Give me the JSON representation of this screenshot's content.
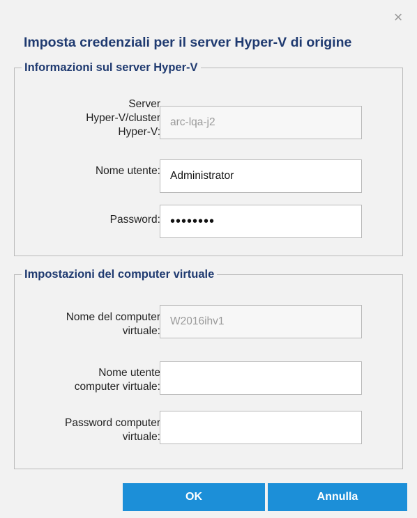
{
  "dialog": {
    "title": "Imposta credenziali per il server Hyper-V di origine",
    "close_symbol": "×"
  },
  "server_section": {
    "legend": "Informazioni sul server Hyper-V",
    "server_label": [
      "Server",
      "Hyper-V/cluster",
      "Hyper-V:"
    ],
    "server_value": "arc-lqa-j2",
    "username_label": "Nome utente:",
    "username_value": "Administrator",
    "password_label": "Password:",
    "password_value": "••••••••"
  },
  "vm_section": {
    "legend": "Impostazioni del computer virtuale",
    "vm_name_label": [
      "Nome del computer",
      "virtuale:"
    ],
    "vm_name_value": "W2016ihv1",
    "vm_username_label": [
      "Nome utente",
      "computer virtuale:"
    ],
    "vm_username_value": "",
    "vm_password_label": [
      "Password computer",
      "virtuale:"
    ],
    "vm_password_value": ""
  },
  "buttons": {
    "ok": "OK",
    "cancel": "Annulla"
  },
  "colors": {
    "title": "#1f3a70",
    "button": "#1c8fd8",
    "background": "#f2f2f2"
  },
  "icons": {
    "close": "close-icon"
  }
}
